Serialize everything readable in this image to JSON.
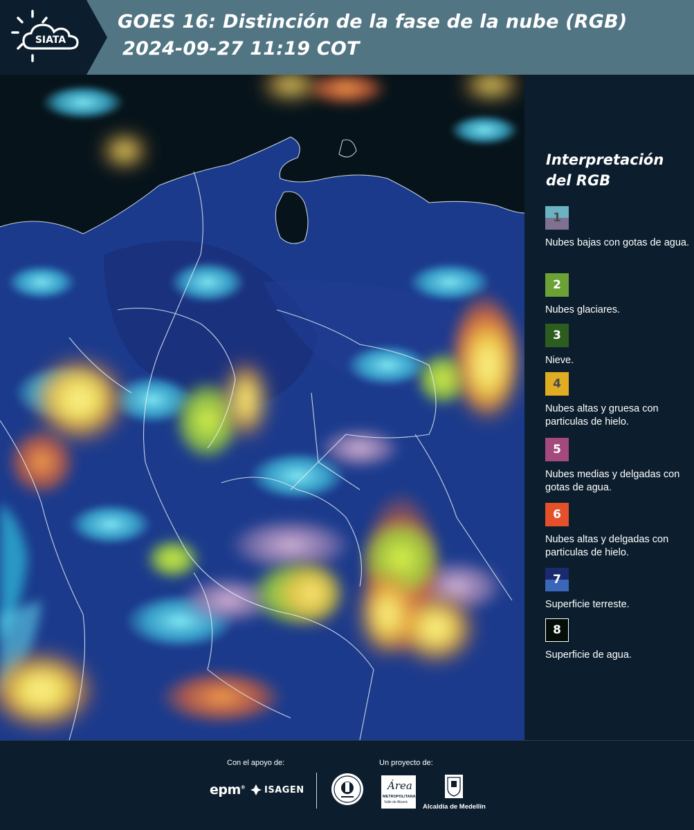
{
  "header": {
    "logo_text": "SIATA",
    "title_line1": "GOES 16: Distinción de la fase de la nube (RGB)",
    "title_line2": "2024-09-27 11:19 COT"
  },
  "legend": {
    "title_line1": "Interpretación",
    "title_line2": "del RGB",
    "items": [
      {
        "number": "1",
        "label": "Nubes bajas con gotas de agua.",
        "color_top": "#6bb3c2",
        "color_bottom": "#7e7191",
        "number_color": "#4a4a4a"
      },
      {
        "number": "2",
        "label": "Nubes glaciares.",
        "color": "#6ba235",
        "number_color": "#ffffff"
      },
      {
        "number": "3",
        "label": "Nieve.",
        "color": "#2c5d1f",
        "number_color": "#ffffff"
      },
      {
        "number": "4",
        "label": "Nubes altas y gruesa con particulas de hielo.",
        "color": "#e0ac21",
        "number_color": "#4a4a4a"
      },
      {
        "number": "5",
        "label": "Nubes medias y delgadas con gotas de agua.",
        "color": "#a3497e",
        "number_color": "#ffffff"
      },
      {
        "number": "6",
        "label": "Nubes altas y delgadas con particulas de hielo.",
        "color": "#e4502a",
        "number_color": "#ffffff"
      },
      {
        "number": "7",
        "label": "Superficie terreste.",
        "color_top": "#1b2a6e",
        "color_bottom": "#3b67b8",
        "number_color": "#ffffff"
      },
      {
        "number": "8",
        "label": "Superficie de agua.",
        "color": "#050d08",
        "number_color": "#ffffff",
        "border": "#ffffff"
      }
    ]
  },
  "footer": {
    "support_label": "Con el apoyo de:",
    "project_label": "Un proyecto de:",
    "epm_logo": "epm",
    "isagen_logo": "ISAGEN",
    "area_logo_main": "Área",
    "area_logo_sub1": "METROPOLITANA",
    "area_logo_sub2": "Valle de Aburrá",
    "alcaldia_label": "Alcaldía de Medellín"
  },
  "colors": {
    "header_bg": "#527583",
    "page_bg": "#0c1e2d",
    "ocean": "#07151d",
    "land": "#1a3a8a"
  }
}
